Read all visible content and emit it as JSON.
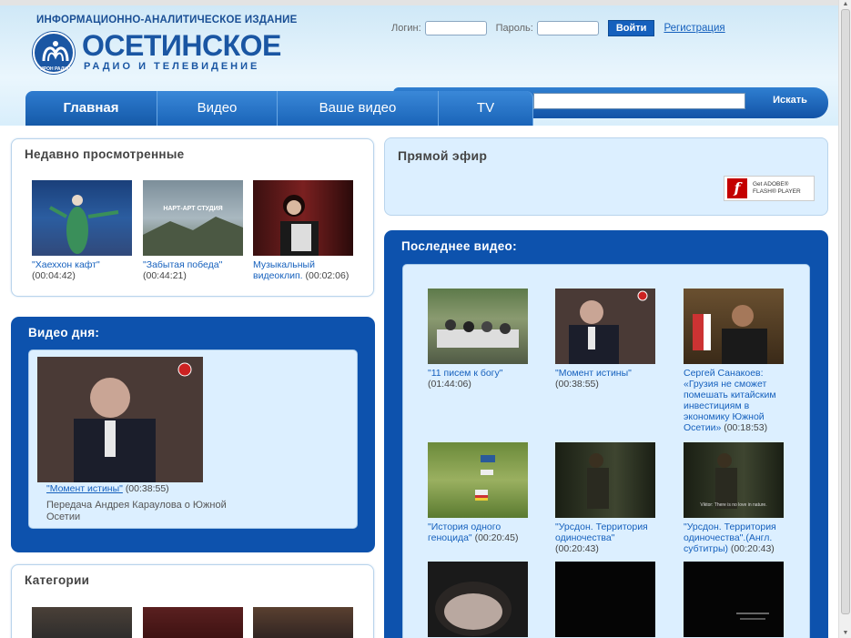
{
  "header": {
    "subtitle": "ИНФОРМАЦИОННО-АНАЛИТИЧЕСКОЕ ИЗДАНИЕ",
    "title": "ОСЕТИНСКОЕ",
    "tagline": "РАДИО И ТЕЛЕВИДЕНИЕ",
    "emblem_text": "ИРОН РАДИО"
  },
  "login": {
    "login_label": "Логин:",
    "password_label": "Пароль:",
    "submit_label": "Войти",
    "register_label": "Регистрация"
  },
  "nav": {
    "tabs": [
      {
        "label": "Главная"
      },
      {
        "label": "Видео"
      },
      {
        "label": "Ваше видео"
      },
      {
        "label": "TV"
      }
    ]
  },
  "search": {
    "button_label": "Искать",
    "value": ""
  },
  "recent": {
    "title": "Недавно просмотренные",
    "items": [
      {
        "title": "\"Хаеххон кафт\"",
        "duration": "(00:04:42)"
      },
      {
        "title": "\"Забытая победа\"",
        "duration": "(00:44:21)"
      },
      {
        "title": "Музыкальный видеоклип.",
        "duration": "(00:02:06)"
      }
    ]
  },
  "video_of_day": {
    "title": "Видео дня:",
    "video_title": "\"Момент истины\"",
    "duration": "(00:38:55)",
    "description": "Передача Андрея Караулова о Южной Осетии"
  },
  "categories": {
    "title": "Категории"
  },
  "live": {
    "title": "Прямой эфир",
    "flash_line1": "Get ADOBE®",
    "flash_line2": "FLASH® PLAYER"
  },
  "latest": {
    "title": "Последнее видео:",
    "items": [
      {
        "title": "\"11 писем к богу\"",
        "duration": "(01:44:06)"
      },
      {
        "title": "\"Момент истины\"",
        "duration": "(00:38:55)"
      },
      {
        "title": "Сергей Санакоев: «Грузия не сможет помешать китайским инвестициям в экономику Южной Осетии»",
        "duration": "(00:18:53)"
      },
      {
        "title": "\"История одного геноцида\"",
        "duration": "(00:20:45)"
      },
      {
        "title": "\"Урсдон. Территория одиночества\"",
        "duration": "(00:20:43)"
      },
      {
        "title": "\"Урсдон. Территория одиночества\".(Англ. субтитры)",
        "duration": "(00:20:43)"
      }
    ]
  },
  "thumb_texts": {
    "nart": "НАРТ-АРТ СТУДИЯ",
    "subtitle_line": "Viktor: There is no love in nature."
  },
  "colors": {
    "brand_blue": "#1a56a3",
    "panel_blue": "#0d52ad",
    "link": "#1560bd",
    "panel_inner": "#dcefff"
  }
}
